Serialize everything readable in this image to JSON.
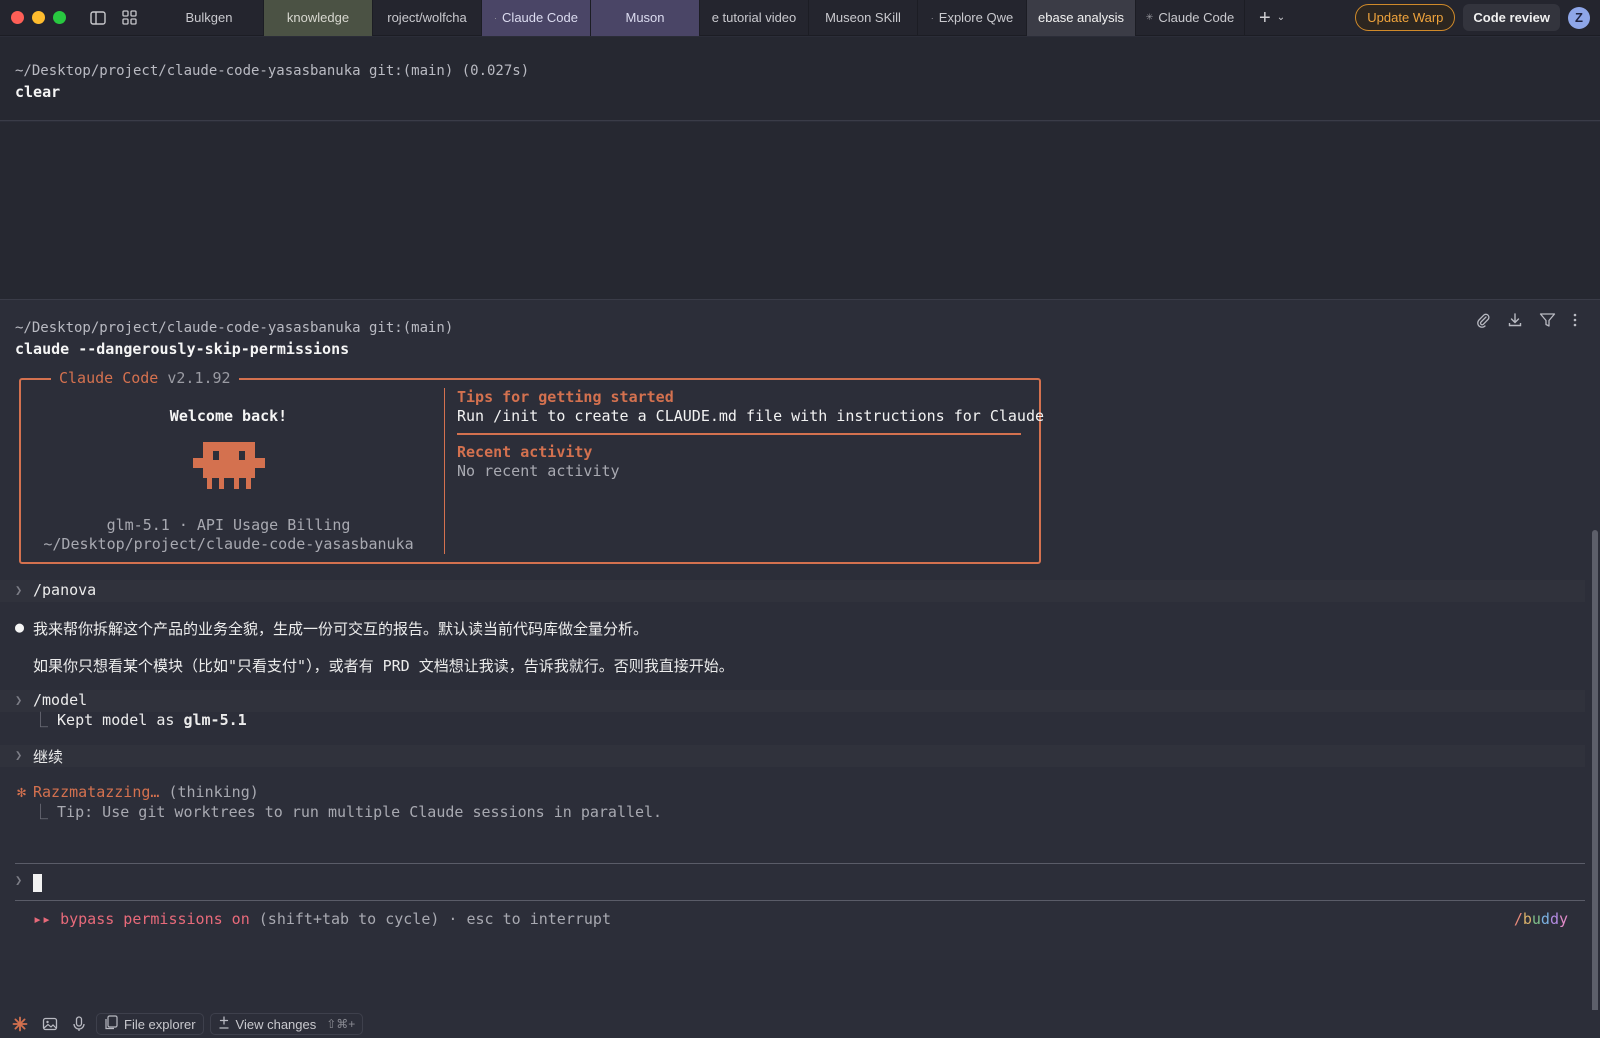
{
  "tabs": [
    {
      "label": "Bulkgen",
      "style": "plain"
    },
    {
      "label": "knowledge",
      "style": "green"
    },
    {
      "label": "roject/wolfcha",
      "style": "plain"
    },
    {
      "label": "Claude Code",
      "style": "purple",
      "prefix": "·"
    },
    {
      "label": "Muson",
      "style": "purple"
    },
    {
      "label": "e tutorial video",
      "style": "plain"
    },
    {
      "label": "Museon SKill",
      "style": "plain"
    },
    {
      "label": "Explore Qwe",
      "style": "plain",
      "prefix": "·"
    },
    {
      "label": "ebase analysis",
      "style": "active"
    },
    {
      "label": "Claude Code",
      "style": "plain",
      "prefix": "✳"
    }
  ],
  "header": {
    "update_label": "Update Warp",
    "review_label": "Code review",
    "avatar_initial": "Z"
  },
  "block1": {
    "cwd": "~/Desktop/project/claude-code-yasasbanuka git:(main)  (0.027s)",
    "command": "clear"
  },
  "block2": {
    "cwd": "~/Desktop/project/claude-code-yasasbanuka git:(main)",
    "command": "claude --dangerously-skip-permissions"
  },
  "welcome_box": {
    "title": "Claude Code",
    "version": "v2.1.92",
    "welcome": "Welcome back!",
    "model_line": "glm-5.1 · API Usage Billing",
    "path_line": "~/Desktop/project/claude-code-yasasbanuka",
    "tips_heading": "Tips for getting started",
    "tips_body": "Run /init to create a CLAUDE.md file with instructions for Claude",
    "recent_heading": "Recent activity",
    "recent_body": "No recent activity"
  },
  "conversation": {
    "cmd_panova": "/panova",
    "reply_line1": "我来帮你拆解这个产品的业务全貌，生成一份可交互的报告。默认读当前代码库做全量分析。",
    "reply_line2": "如果你只想看某个模块（比如\"只看支付\"），或者有 PRD 文档想让我读，告诉我就行。否则我直接开始。",
    "cmd_model": "/model",
    "model_result_prefix": "Kept model as ",
    "model_result_value": "glm-5.1",
    "cmd_continue": "继续",
    "thinking_word": "Razzmatazzing…",
    "thinking_suffix": " (thinking)",
    "tip": "Tip: Use git worktrees to run multiple Claude sessions in parallel."
  },
  "status": {
    "arrows": "▸▸",
    "bypass": "bypass permissions on",
    "hint": " (shift+tab to cycle) · esc to interrupt",
    "buddy": [
      "/",
      "b",
      "u",
      "d",
      "d",
      "y"
    ]
  },
  "bottombar": {
    "file_explorer": "File explorer",
    "view_changes": "View changes",
    "view_changes_kbd": "⇧⌘+"
  },
  "colors": {
    "accent": "#d4714f",
    "update_warp": "#f0a43c",
    "bypass": "#e86a7a"
  }
}
